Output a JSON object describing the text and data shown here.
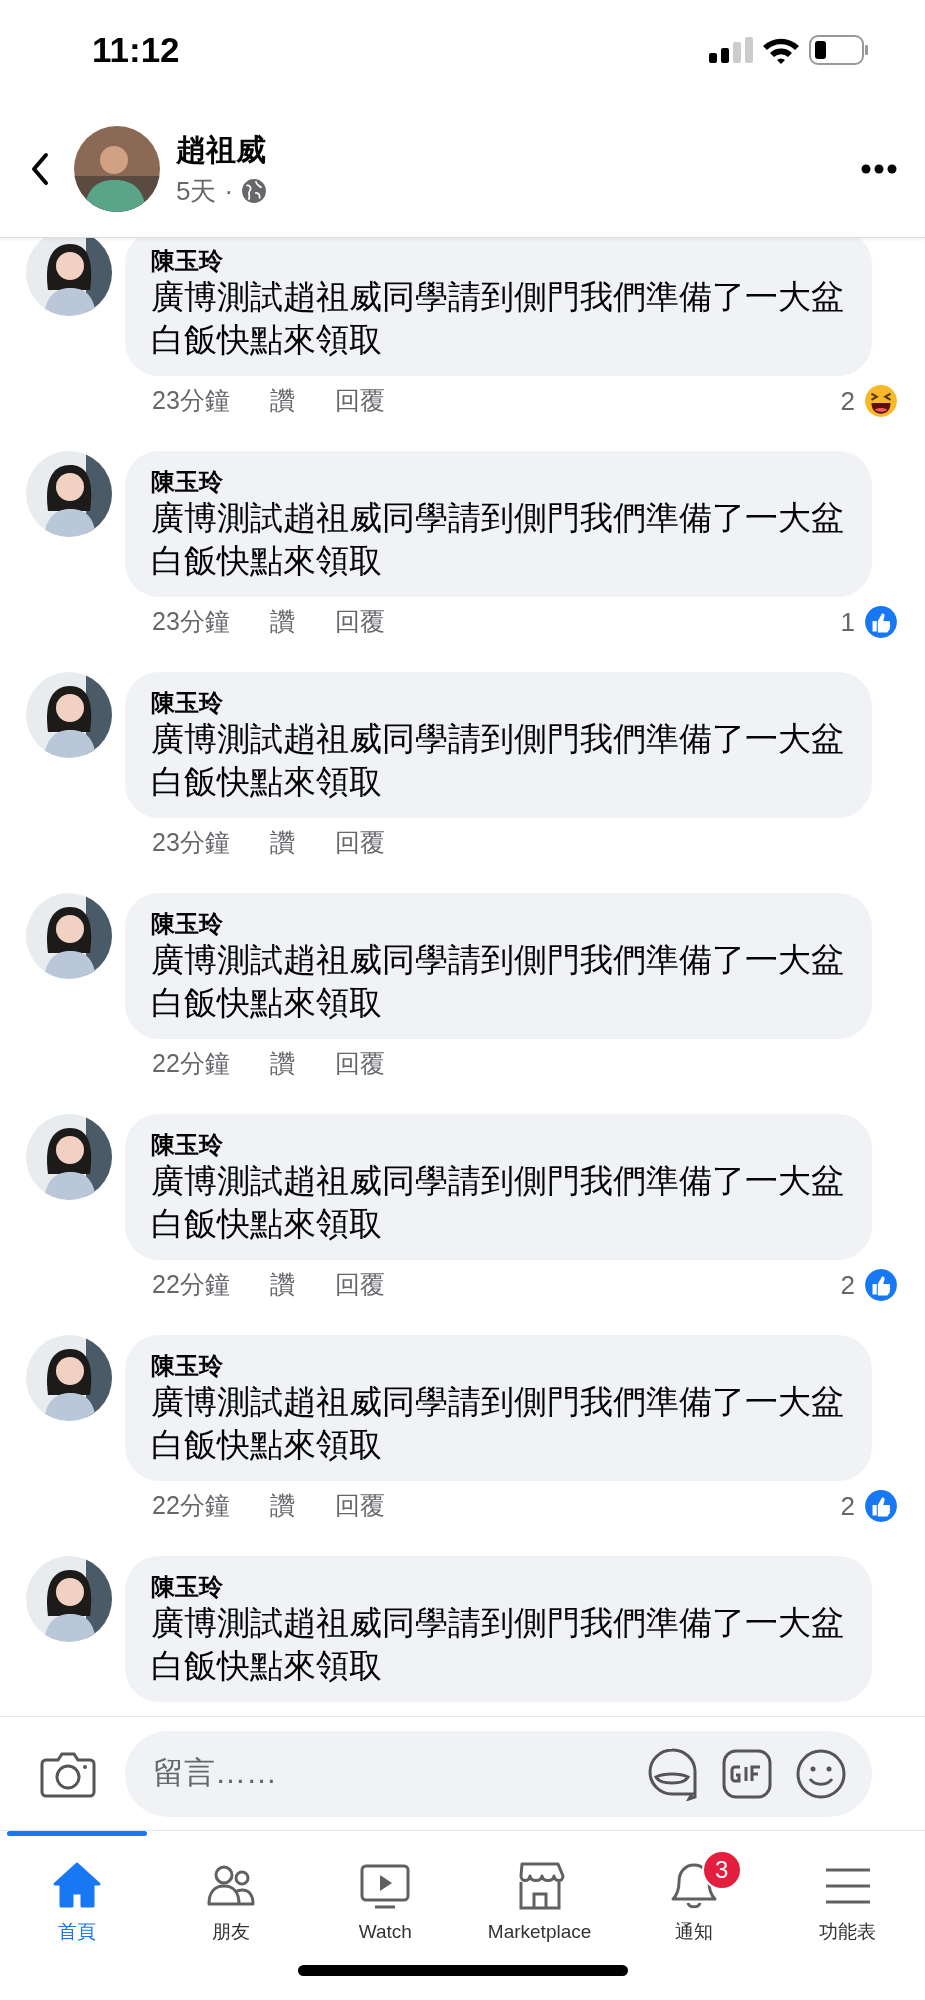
{
  "status_bar": {
    "time": "11:12"
  },
  "header": {
    "name": "趙祖威",
    "age": "5天",
    "separator": "·"
  },
  "comments": [
    {
      "author": "陳玉玲",
      "text": "廣博測試趙祖威同學請到側門我們準備了一大盆白飯快點來領取",
      "time": "23分鐘",
      "like_label": "讚",
      "reply_label": "回覆",
      "reaction_count": "2",
      "reactions": [
        {
          "kind": "haha"
        }
      ]
    },
    {
      "author": "陳玉玲",
      "text": "廣博測試趙祖威同學請到側門我們準備了一大盆白飯快點來領取",
      "time": "23分鐘",
      "like_label": "讚",
      "reply_label": "回覆",
      "reaction_count": "1",
      "reactions": [
        {
          "kind": "like"
        }
      ]
    },
    {
      "author": "陳玉玲",
      "text": "廣博測試趙祖威同學請到側門我們準備了一大盆白飯快點來領取",
      "time": "23分鐘",
      "like_label": "讚",
      "reply_label": "回覆"
    },
    {
      "author": "陳玉玲",
      "text": "廣博測試趙祖威同學請到側門我們準備了一大盆白飯快點來領取",
      "time": "22分鐘",
      "like_label": "讚",
      "reply_label": "回覆"
    },
    {
      "author": "陳玉玲",
      "text": "廣博測試趙祖威同學請到側門我們準備了一大盆白飯快點來領取",
      "time": "22分鐘",
      "like_label": "讚",
      "reply_label": "回覆",
      "reaction_count": "2",
      "reactions": [
        {
          "kind": "like"
        }
      ]
    },
    {
      "author": "陳玉玲",
      "text": "廣博測試趙祖威同學請到側門我們準備了一大盆白飯快點來領取",
      "time": "22分鐘",
      "like_label": "讚",
      "reply_label": "回覆",
      "reaction_count": "2",
      "reactions": [
        {
          "kind": "like"
        }
      ]
    },
    {
      "author": "陳玉玲",
      "text": "廣博測試趙祖威同學請到側門我們準備了一大盆白飯快點來領取"
    }
  ],
  "composer": {
    "placeholder": "留言……"
  },
  "tabs": [
    {
      "label": "首頁",
      "selected": true
    },
    {
      "label": "朋友",
      "selected": false
    },
    {
      "label": "Watch",
      "selected": false
    },
    {
      "label": "Marketplace",
      "selected": false
    },
    {
      "label": "通知",
      "selected": false,
      "badge": "3"
    },
    {
      "label": "功能表",
      "selected": false
    }
  ]
}
